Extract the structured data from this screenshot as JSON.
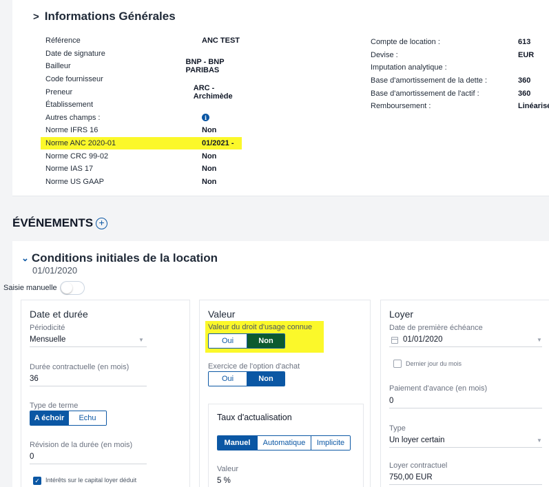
{
  "info": {
    "title": "Informations Générales",
    "left_rows": [
      {
        "label": "Référence",
        "value": "ANC TEST"
      },
      {
        "label": "Date de signature",
        "value": ""
      },
      {
        "label": "Bailleur",
        "value": "BNP - BNP PARIBAS"
      },
      {
        "label": "Code fournisseur",
        "value": ""
      },
      {
        "label": "Preneur",
        "value": "ARC - Archimède"
      },
      {
        "label": "Établissement",
        "value": ""
      },
      {
        "label": "Autres champs :",
        "value": ""
      },
      {
        "label": "Norme IFRS 16",
        "value": "Non"
      },
      {
        "label": "Norme ANC 2020-01",
        "value": "01/2021 -"
      },
      {
        "label": "Norme CRC 99-02",
        "value": "Non"
      },
      {
        "label": "Norme IAS 17",
        "value": "Non"
      },
      {
        "label": "Norme US GAAP",
        "value": "Non"
      }
    ],
    "right_rows": [
      {
        "label": "Compte de location :",
        "value": "613"
      },
      {
        "label": "Devise :",
        "value": "EUR"
      },
      {
        "label": "Imputation analytique :",
        "value": ""
      },
      {
        "label": "Base d'amortissement de la dette :",
        "value": "360"
      },
      {
        "label": "Base d'amortissement de l'actif :",
        "value": "360"
      },
      {
        "label": "Remboursement :",
        "value": "Linéarisé"
      }
    ],
    "info_icon": "i"
  },
  "events": {
    "title": "ÉVÉNEMENTS",
    "add_icon": "+"
  },
  "conditions": {
    "title": "Conditions initiales de la location",
    "date": "01/01/2020",
    "manual_label": "Saisie manuelle",
    "date_duree": {
      "title": "Date et durée",
      "periodicite_label": "Périodicité",
      "periodicite_value": "Mensuelle",
      "duree_label": "Durée contractuelle (en mois)",
      "duree_value": "36",
      "type_terme_label": "Type de terme",
      "terme_options": [
        "A échoir",
        "Echu"
      ],
      "revision_label": "Révision de la durée (en mois)",
      "revision_value": "0",
      "interets_label": "Intérêts sur le capital loyer déduit"
    },
    "valeur": {
      "title": "Valeur",
      "droit_label": "Valeur du droit d'usage connue",
      "droit_options": [
        "Oui",
        "Non"
      ],
      "option_achat_label": "Exercice de l'option d'achat",
      "option_achat_options": [
        "Oui",
        "Non"
      ],
      "taux_title": "Taux d'actualisation",
      "taux_options": [
        "Manuel",
        "Automatique",
        "Implicite"
      ],
      "taux_valeur_label": "Valeur",
      "taux_valeur": "5 %"
    },
    "loyer": {
      "title": "Loyer",
      "premiere_echeance_label": "Date de première échéance",
      "premiere_echeance_value": "01/01/2020",
      "dernier_jour_label": "Dernier jour du mois",
      "paiement_label": "Paiement d'avance (en mois)",
      "paiement_value": "0",
      "type_label": "Type",
      "type_value": "Un loyer certain",
      "loyer_label": "Loyer contractuel",
      "loyer_value": "750,00 EUR"
    }
  },
  "colors": {
    "accent": "#0b57a4",
    "highlight": "#fbf82a",
    "selected_green": "#0c5a2f"
  }
}
